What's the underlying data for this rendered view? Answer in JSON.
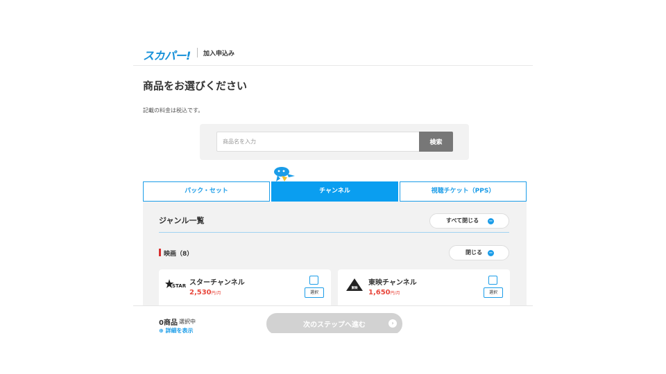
{
  "header": {
    "logo_text": "スカパー!",
    "title": "加入申込み"
  },
  "page": {
    "title": "商品をお選びください",
    "tax_note": "記載の料金は税込です。"
  },
  "search": {
    "placeholder": "商品名を入力",
    "button_label": "検索"
  },
  "tabs": [
    {
      "label": "パック・セット",
      "active": false
    },
    {
      "label": "チャンネル",
      "active": true
    },
    {
      "label": "視聴チケット（PPS）",
      "active": false
    }
  ],
  "genre": {
    "title": "ジャンル一覧",
    "close_all_label": "すべて閉じる",
    "category_title": "映画（8）",
    "close_label": "閉じる"
  },
  "channels": [
    {
      "name": "スターチャンネル",
      "price": "2,530",
      "unit": "円/月",
      "logo_text": "STAR",
      "select_label": "選択"
    },
    {
      "name": "東映チャンネル",
      "price": "1,650",
      "unit": "円/月",
      "logo_text": "東映",
      "select_label": "選択"
    }
  ],
  "footer": {
    "count": "0商品",
    "count_label": "選択中",
    "detail_link": "詳細を表示",
    "next_label": "次のステップへ進む"
  },
  "colors": {
    "brand_blue": "#0a9ef0",
    "price_red": "#e8473c",
    "category_red": "#d83030"
  }
}
